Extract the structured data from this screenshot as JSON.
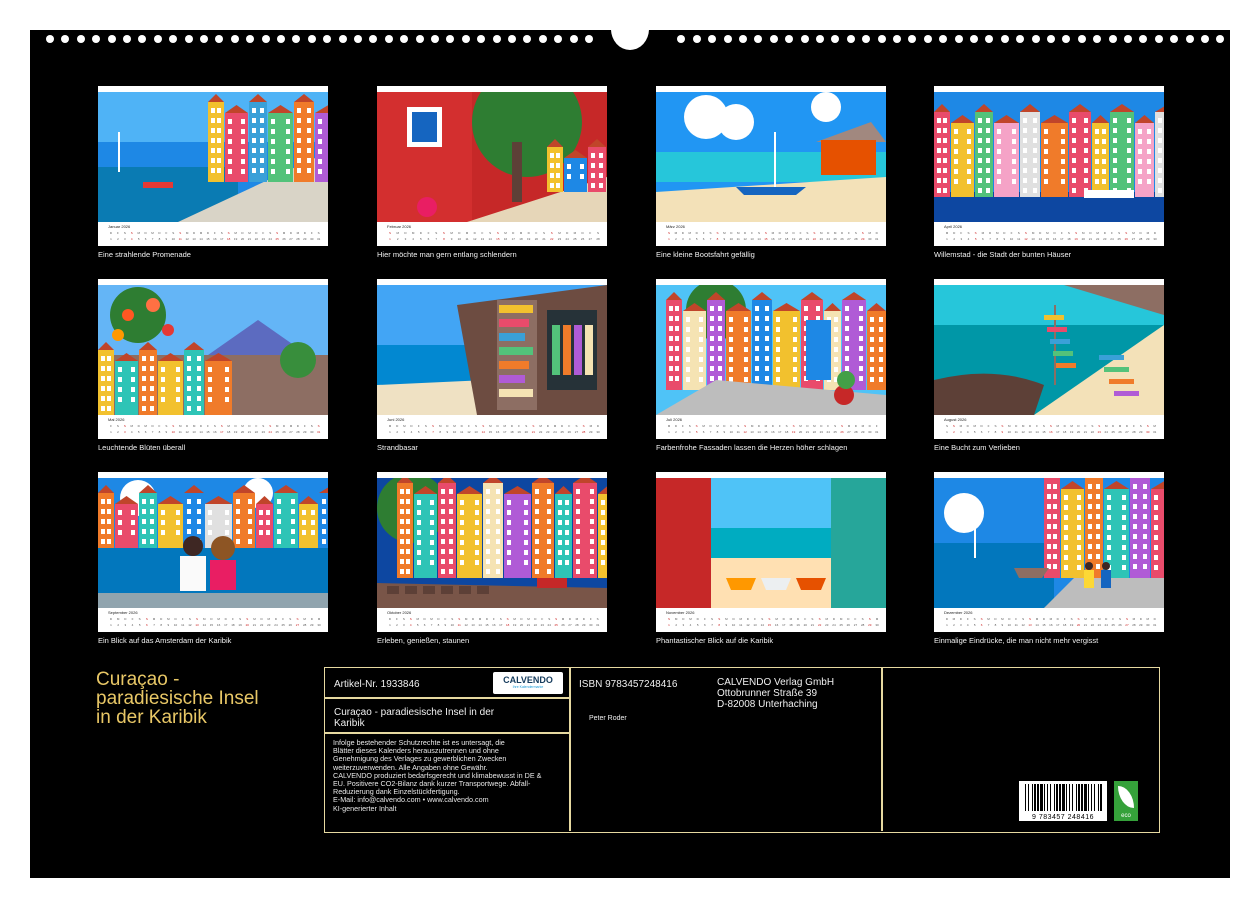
{
  "months": [
    {
      "name": "Januar 2026",
      "caption": "Eine strahlende Promenade",
      "first_weekday": 3,
      "days": 31
    },
    {
      "name": "Februar 2026",
      "caption": "Hier möchte man gern entlang schlendern",
      "first_weekday": 6,
      "days": 28
    },
    {
      "name": "März 2026",
      "caption": "Eine kleine Bootsfahrt gefällig",
      "first_weekday": 6,
      "days": 31
    },
    {
      "name": "April 2026",
      "caption": "Willemstad - die Stadt der bunten Häuser",
      "first_weekday": 2,
      "days": 30
    },
    {
      "name": "Mai 2026",
      "caption": "Leuchtende Blüten überall",
      "first_weekday": 4,
      "days": 31
    },
    {
      "name": "Juni 2026",
      "caption": "Strandbasar",
      "first_weekday": 0,
      "days": 30
    },
    {
      "name": "Juli 2026",
      "caption": "Farbenfrohe Fassaden lassen die Herzen höher schlagen",
      "first_weekday": 2,
      "days": 31
    },
    {
      "name": "August 2026",
      "caption": "Eine Bucht zum Verlieben",
      "first_weekday": 5,
      "days": 31
    },
    {
      "name": "September 2026",
      "caption": "Ein Blick auf das Amsterdam der Karibik",
      "first_weekday": 1,
      "days": 30
    },
    {
      "name": "Oktober 2026",
      "caption": "Erleben, genießen, staunen",
      "first_weekday": 3,
      "days": 31
    },
    {
      "name": "November 2026",
      "caption": "Phantastischer Blick auf die Karibik",
      "first_weekday": 6,
      "days": 30
    },
    {
      "name": "Dezember 2026",
      "caption": "Einmalige Eindrücke, die man nicht mehr vergisst",
      "first_weekday": 1,
      "days": 31
    }
  ],
  "weekday_letters": [
    "M",
    "D",
    "M",
    "D",
    "F",
    "S",
    "S"
  ],
  "title": {
    "line1": "Curaçao -",
    "line2": "paradiesische Insel",
    "line3": "in der Karibik"
  },
  "info": {
    "article_no": "Artikel-Nr. 1933846",
    "logo_text": "CALVENDO",
    "logo_sub": "Ihre Kalendermarke",
    "product_title_line1": "Curaçao - paradiesische Insel in der",
    "product_title_line2": "Karibik",
    "isbn": "ISBN 9783457248416",
    "author": "Peter Roder",
    "publisher_line1": "CALVENDO Verlag GmbH",
    "publisher_line2": "Ottobrunner Straße 39",
    "publisher_line3": "D-82008 Unterhaching",
    "legal": [
      "Infolge bestehender Schutzrechte ist es untersagt, die",
      "Blätter dieses Kalenders herauszutrennen und ohne",
      "Genehmigung des Verlages zu gewerblichen Zwecken",
      "weiterzuverwenden. Alle Angaben ohne Gewähr.",
      "CALVENDO produziert bedarfsgerecht und klimabewusst in DE &",
      "EU. Positivere CO2-Bilanz dank kurzer Transportwege. Abfall-",
      "Reduzierung dank Einzelstückfertigung.",
      "E-Mail: info@calvendo.com • www.calvendo.com",
      "KI-generierter Inhalt"
    ],
    "barcode_number": "9 783457 248416",
    "eco_label": "eco"
  },
  "colors": {
    "background": "#000000",
    "title_gold": "#e8c766",
    "frame": "#e6d9a0",
    "weekend": "#cc2222",
    "eco_green": "#35a13a"
  }
}
